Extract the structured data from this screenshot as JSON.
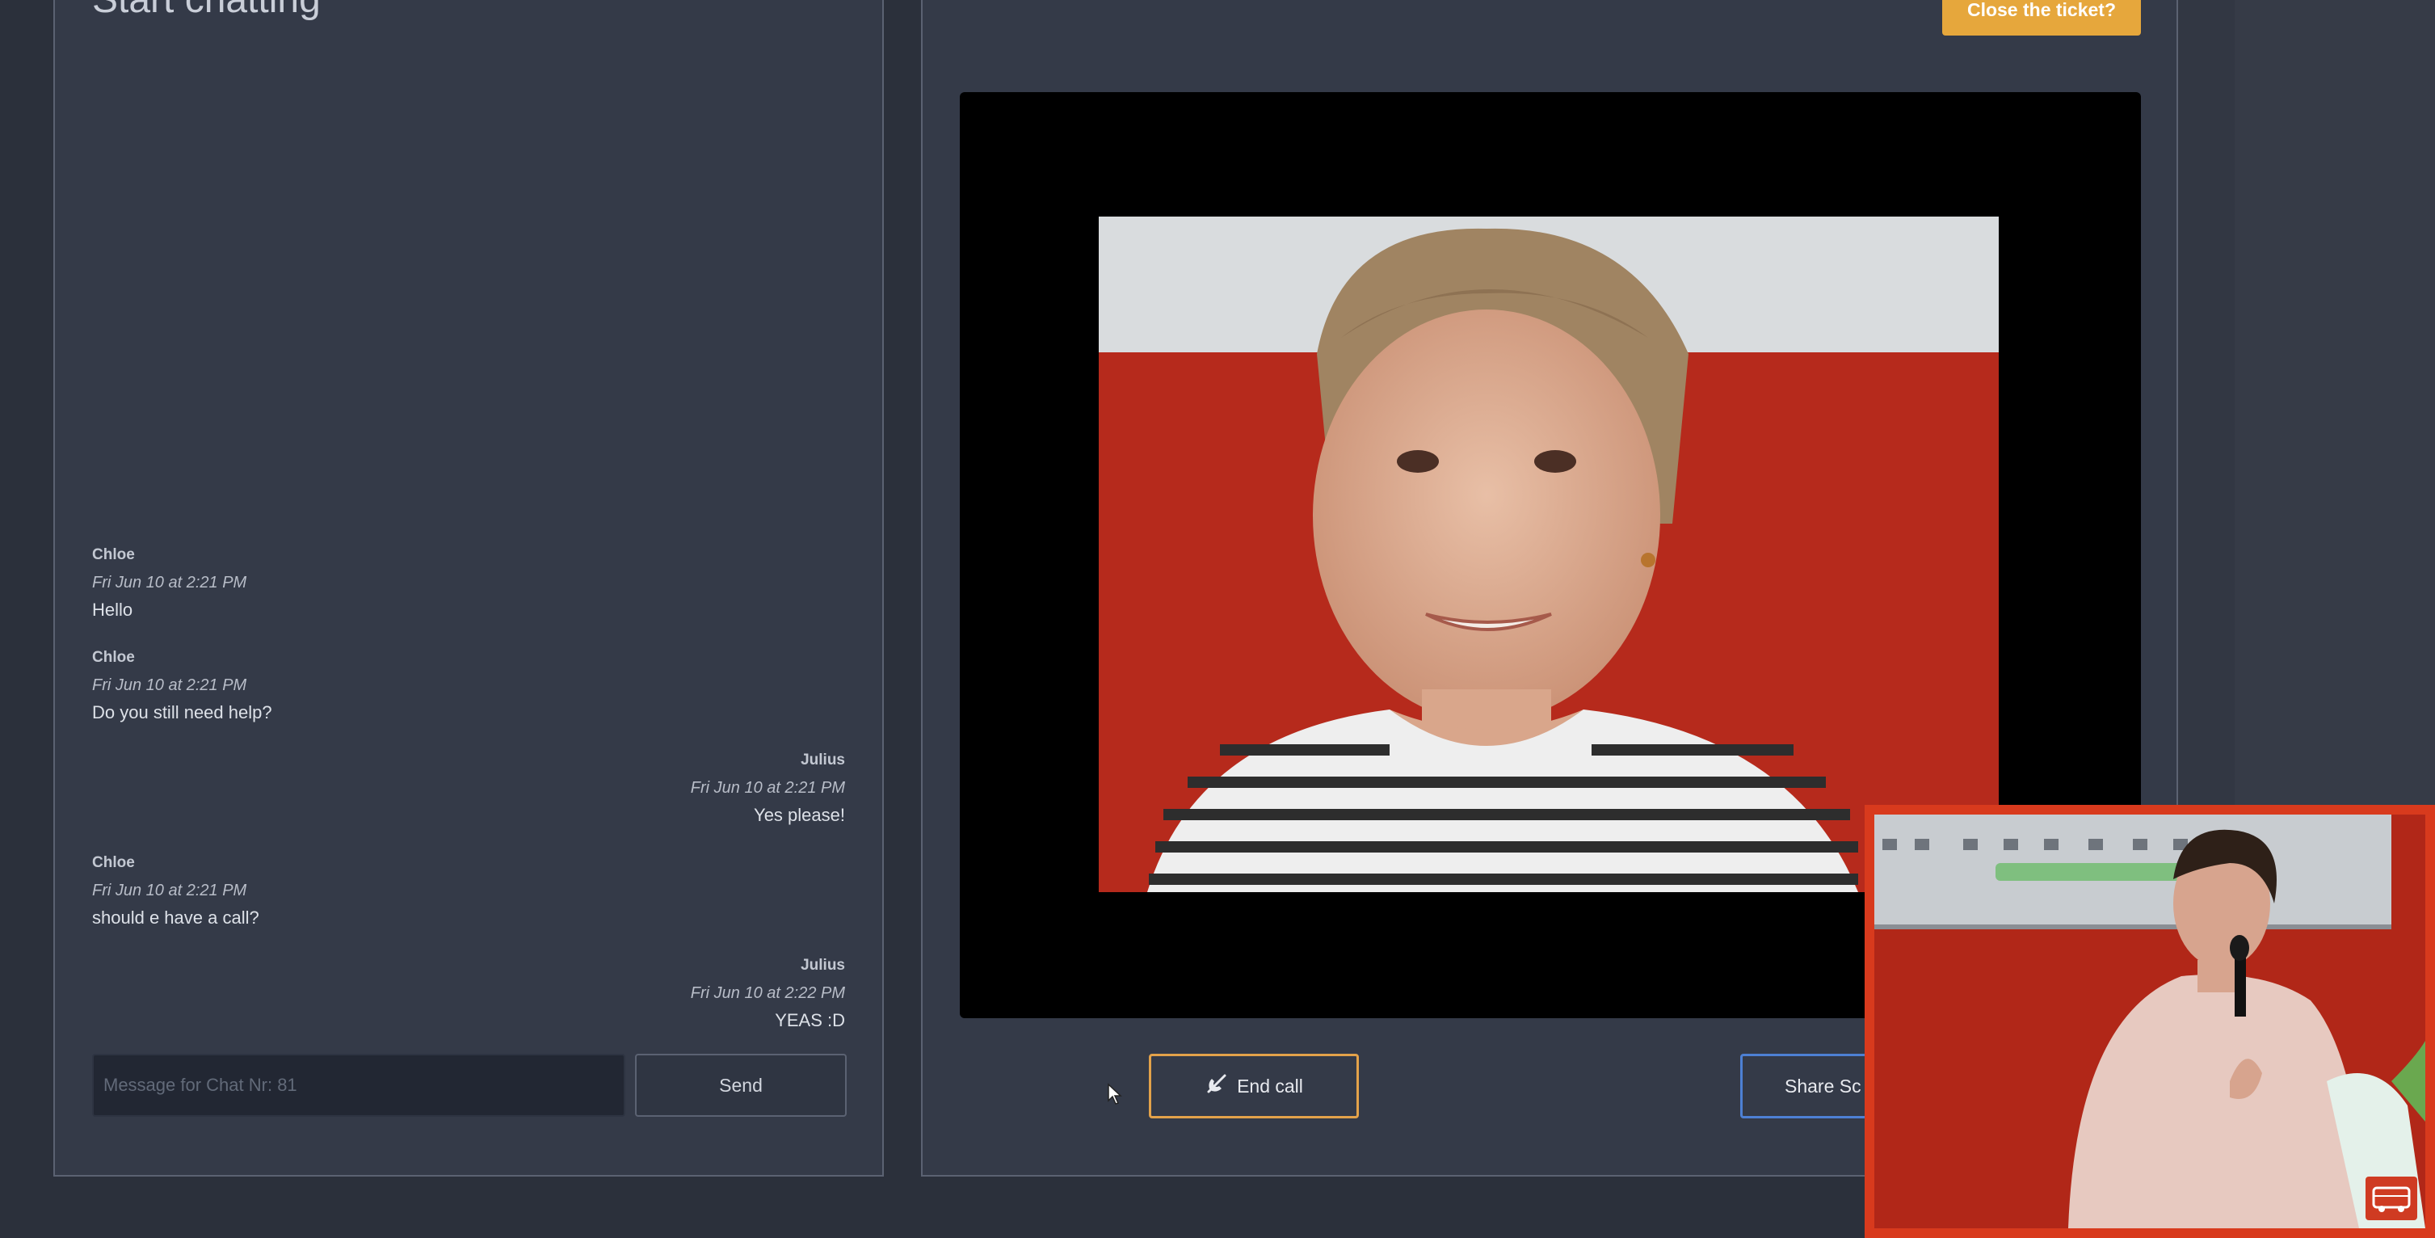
{
  "chat": {
    "title": "Start chatting",
    "messages": [
      {
        "sender": "Chloe",
        "time": "Fri Jun 10 at 2:21 PM",
        "text": "Hello",
        "align": "left"
      },
      {
        "sender": "Chloe",
        "time": "Fri Jun 10 at 2:21 PM",
        "text": "Do you still need help?",
        "align": "left"
      },
      {
        "sender": "Julius",
        "time": "Fri Jun 10 at 2:21 PM",
        "text": "Yes please!",
        "align": "right"
      },
      {
        "sender": "Chloe",
        "time": "Fri Jun 10 at 2:21 PM",
        "text": "should e have a call?",
        "align": "left"
      },
      {
        "sender": "Julius",
        "time": "Fri Jun 10 at 2:22 PM",
        "text": "YEAS :D",
        "align": "right"
      }
    ],
    "input": {
      "placeholder": "Message for Chat Nr: 81",
      "value": ""
    },
    "send_label": "Send"
  },
  "video": {
    "close_ticket_label": "Close the ticket?",
    "end_call_label": "End call",
    "share_screen_label": "Share Sc",
    "end_call_icon": "phone-hangup-icon"
  },
  "overlay": {
    "badge_icon": "van-icon"
  },
  "colors": {
    "page_bg": "#2b303b",
    "panel_bg": "#343a48",
    "panel_border": "#5b6272",
    "close_ticket_bg": "#e6a73c",
    "end_call_border": "#e3a24a",
    "share_screen_border": "#4d80d4",
    "pip_border": "#d83a1d"
  }
}
